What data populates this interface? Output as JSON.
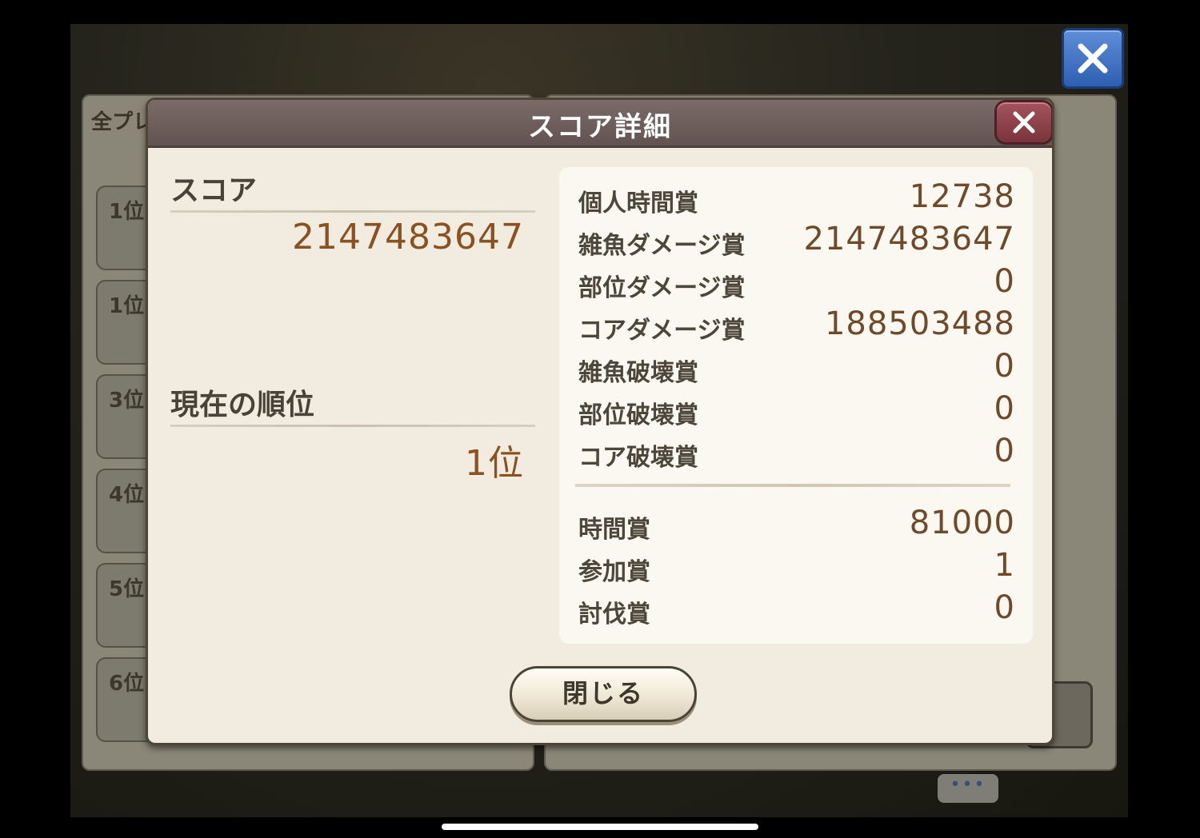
{
  "background": {
    "tab_label": "全プレ",
    "rank_tabs": [
      "1位",
      "1位",
      "3位",
      "4位",
      "5位",
      "6位"
    ],
    "chat_bubble": "•••"
  },
  "dialog": {
    "title": "スコア詳細",
    "score_label": "スコア",
    "score_value": "2147483647",
    "rank_label": "現在の順位",
    "rank_value": "1位",
    "details": [
      {
        "label": "個人時間賞",
        "value": "12738"
      },
      {
        "label": "雑魚ダメージ賞",
        "value": "2147483647"
      },
      {
        "label": "部位ダメージ賞",
        "value": "0"
      },
      {
        "label": "コアダメージ賞",
        "value": "188503488"
      },
      {
        "label": "雑魚破壊賞",
        "value": "0"
      },
      {
        "label": "部位破壊賞",
        "value": "0"
      },
      {
        "label": "コア破壊賞",
        "value": "0"
      }
    ],
    "bonuses": [
      {
        "label": "時間賞",
        "value": "81000"
      },
      {
        "label": "参加賞",
        "value": "1"
      },
      {
        "label": "討伐賞",
        "value": "0"
      }
    ],
    "close_button": "閉じる"
  },
  "icons": {
    "outer_close": "close-icon",
    "dialog_close": "close-icon"
  },
  "colors": {
    "header": "#6f605d",
    "accent_value": "#8a5223",
    "panel_bg": "#f1ecdf",
    "outer_close_bg": "#3f6fc0",
    "dialog_close_bg": "#8f434c"
  }
}
